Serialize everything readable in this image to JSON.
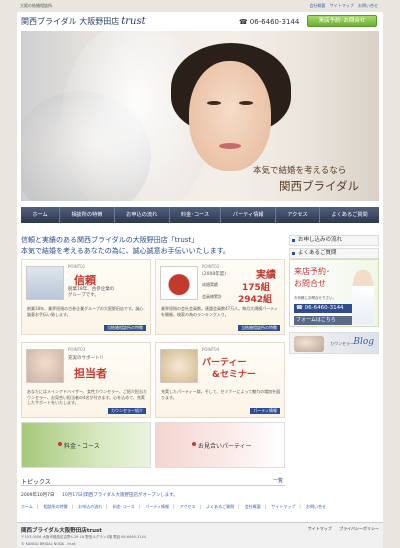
{
  "top": {
    "tagline": "大阪の結婚相談所",
    "links": [
      "会社概要",
      "サイトマップ",
      "お問い合せ"
    ]
  },
  "header": {
    "logo_text": "関西ブライダル 大阪野田店",
    "logo_brand": "trust",
    "phone": "06-6460-3144",
    "reserve_label": "来店予約･お問合せ"
  },
  "hero": {
    "subtitle": "本気で結婚を考えるなら",
    "title": "関西ブライダル"
  },
  "nav": [
    "ホーム",
    "相談所の特徴",
    "お申込の流れ",
    "料金･コース",
    "パーティ情報",
    "アクセス",
    "よくあるご質問"
  ],
  "intro": {
    "line1": "信頼と実績のある関西ブライダルの大阪野田店「trust」",
    "line2": "本気で結婚を考えるあなたの為に、誠心誠意お手伝いいたします。"
  },
  "cards": [
    {
      "point": "POINT01",
      "title": "信頼",
      "sub": "創業18年、古参企業の",
      "sub2": "グループです。",
      "desc": "創業18年、業界屈指の古参企業グループの大阪野田店です。誠心誠意お手伝い致します。",
      "link": "当結婚相談所の特徴"
    },
    {
      "point": "POINT02",
      "title": "実績",
      "sub": "(2008年度)",
      "count": "175組",
      "sub3": "成婚実績",
      "total": "2942組",
      "sub4": "会員様累計",
      "desc": "業界屈指の会社会員数。連盟会員数47万人。毎月大規模パーティを開催。検索の為のランキング入り。",
      "link": "当結婚相談所の特徴"
    },
    {
      "point": "POINT03",
      "title": "担当者",
      "sub": "充実のサポート!!",
      "desc": "あなたにはメインアドバイザー、女性カウンセラー、ご紹介担当カウンセラー、お見合い担当者の4名が付きます。心を込めて、充実したサポートをいたします。",
      "link": "カウンセラー紹介"
    },
    {
      "point": "POINT04",
      "title": "パーティー",
      "title2": "&セミナー",
      "sub": "",
      "desc": "充実したパーティー群。そして、セミナーによって魅力の増加を図ります。",
      "link": "パーティ情報"
    }
  ],
  "banners": [
    "料金・コース",
    "お見合いパーティー"
  ],
  "topics": {
    "title": "トピックス",
    "more": "一覧"
  },
  "news": {
    "date": "2009年10月7日",
    "text": "10月17日(関西ブライダル大阪野田店がオープンします。"
  },
  "sidebar": {
    "links": [
      "お申し込みの流れ",
      "よくあるご質問"
    ],
    "reserve_t1": "来店予約･",
    "reserve_t2": "お問合せ",
    "reserve_pre": "お気軽にお問合せ下さい。",
    "reserve_phone": "☎ 06-6460-3144",
    "reserve_form": "フォームはこちら",
    "blog_caption": "カウンセラー",
    "blog_label": "Blog"
  },
  "footlinks": [
    "ホーム",
    "相談所の特徴",
    "お申込の流れ",
    "料金･コース",
    "パーティ情報",
    "アクセス",
    "よくあるご質問",
    "会社概要",
    "サイトマップ",
    "お問い合せ"
  ],
  "footer": {
    "name": "関西ブライダル大阪野田店trust",
    "address": "〒553-0006 大阪市福島区吉野4-29-18 野田ルグラン1階 電話 06-6460-3144",
    "copy": "© KANSAI BRIDAL NODA - trust",
    "right1": "サイトマップ",
    "right2": "プライバシーポリシー"
  }
}
